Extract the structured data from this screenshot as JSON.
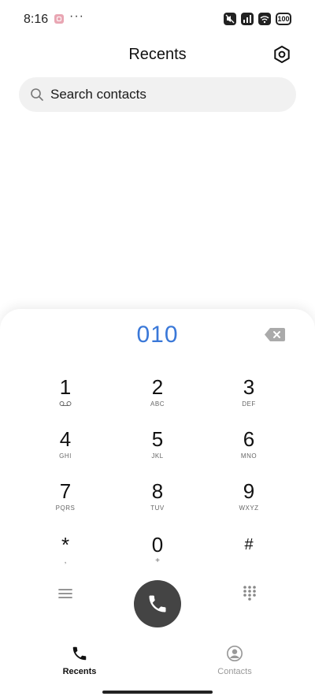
{
  "status_bar": {
    "time": "8:16",
    "more": "···",
    "battery": "100",
    "icons": [
      "notification-app-icon",
      "mute-icon",
      "signal-icon",
      "wifi-icon",
      "battery-icon"
    ]
  },
  "header": {
    "title": "Recents",
    "settings_icon": "settings-icon"
  },
  "search": {
    "placeholder": "Search contacts"
  },
  "dialer": {
    "number": "010",
    "keys": [
      {
        "digit": "1",
        "letters": ""
      },
      {
        "digit": "2",
        "letters": "ABC"
      },
      {
        "digit": "3",
        "letters": "DEF"
      },
      {
        "digit": "4",
        "letters": "GHI"
      },
      {
        "digit": "5",
        "letters": "JKL"
      },
      {
        "digit": "6",
        "letters": "MNO"
      },
      {
        "digit": "7",
        "letters": "PQRS"
      },
      {
        "digit": "8",
        "letters": "TUV"
      },
      {
        "digit": "9",
        "letters": "WXYZ"
      },
      {
        "digit": "*",
        "letters": ","
      },
      {
        "digit": "0",
        "letters": "+"
      },
      {
        "digit": "#",
        "letters": ""
      }
    ]
  },
  "bottom_nav": {
    "items": [
      {
        "label": "Recents",
        "icon": "phone-icon",
        "active": true
      },
      {
        "label": "Contacts",
        "icon": "person-icon",
        "active": false
      }
    ]
  },
  "colors": {
    "accent": "#3a78d8",
    "call_button": "#444444"
  }
}
